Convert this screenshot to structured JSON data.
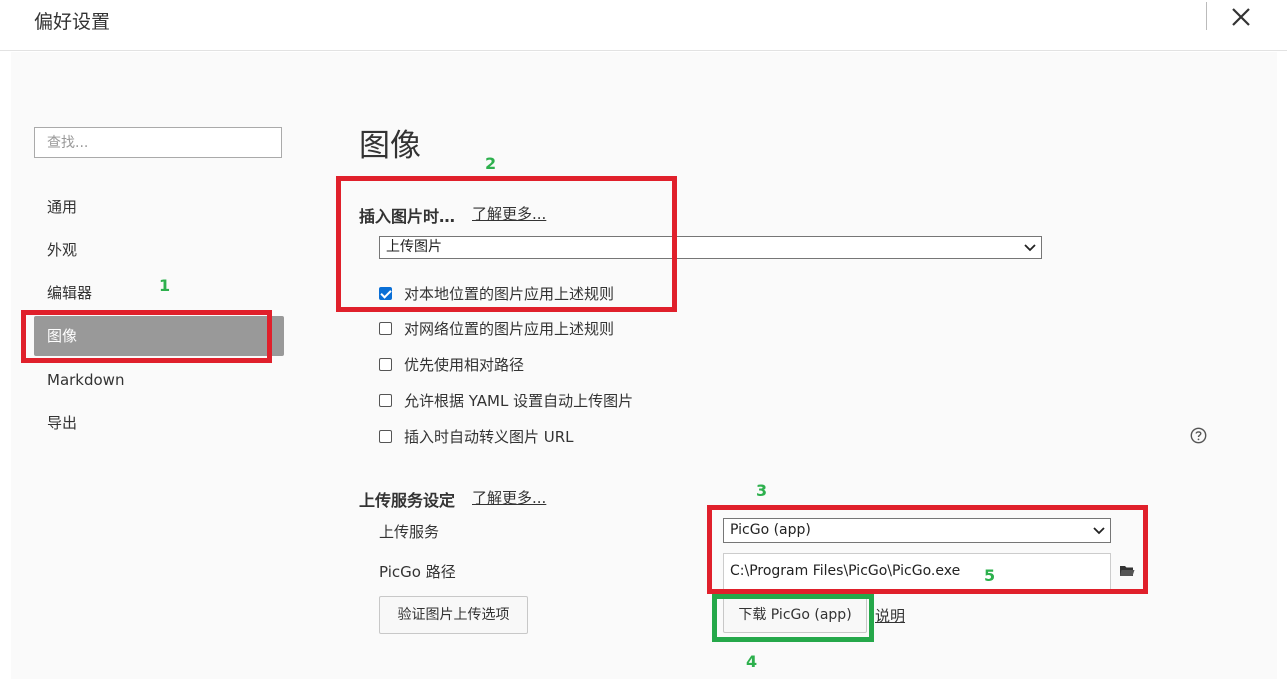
{
  "window": {
    "title": "偏好设置",
    "close_icon": "close-icon"
  },
  "sidebar": {
    "search_placeholder": "查找...",
    "items": [
      {
        "label": "通用",
        "active": false
      },
      {
        "label": "外观",
        "active": false
      },
      {
        "label": "编辑器",
        "active": false
      },
      {
        "label": "图像",
        "active": true
      },
      {
        "label": "Markdown",
        "active": false
      },
      {
        "label": "导出",
        "active": false
      }
    ]
  },
  "main": {
    "title": "图像",
    "insert_section": {
      "title": "插入图片时…",
      "learn_more": "了解更多...",
      "action_select": "上传图片",
      "options": [
        {
          "label": "对本地位置的图片应用上述规则",
          "checked": true
        },
        {
          "label": "对网络位置的图片应用上述规则",
          "checked": false
        },
        {
          "label": "优先使用相对路径",
          "checked": false
        },
        {
          "label": "允许根据 YAML 设置自动上传图片",
          "checked": false
        },
        {
          "label": "插入时自动转义图片 URL",
          "checked": false
        }
      ]
    },
    "upload_section": {
      "title": "上传服务设定",
      "learn_more": "了解更多...",
      "service_label": "上传服务",
      "service_value": "PicGo (app)",
      "path_label": "PicGo 路径",
      "path_value": "C:\\Program Files\\PicGo\\PicGo.exe",
      "verify_button": "验证图片上传选项",
      "download_button": "下载 PicGo (app)",
      "explain_link": "说明"
    }
  },
  "annotations": {
    "n1": "1",
    "n2": "2",
    "n3": "3",
    "n4": "4",
    "n5": "5",
    "red": "#e0202b",
    "green": "#25a84a",
    "number_color": "#2db04d"
  }
}
